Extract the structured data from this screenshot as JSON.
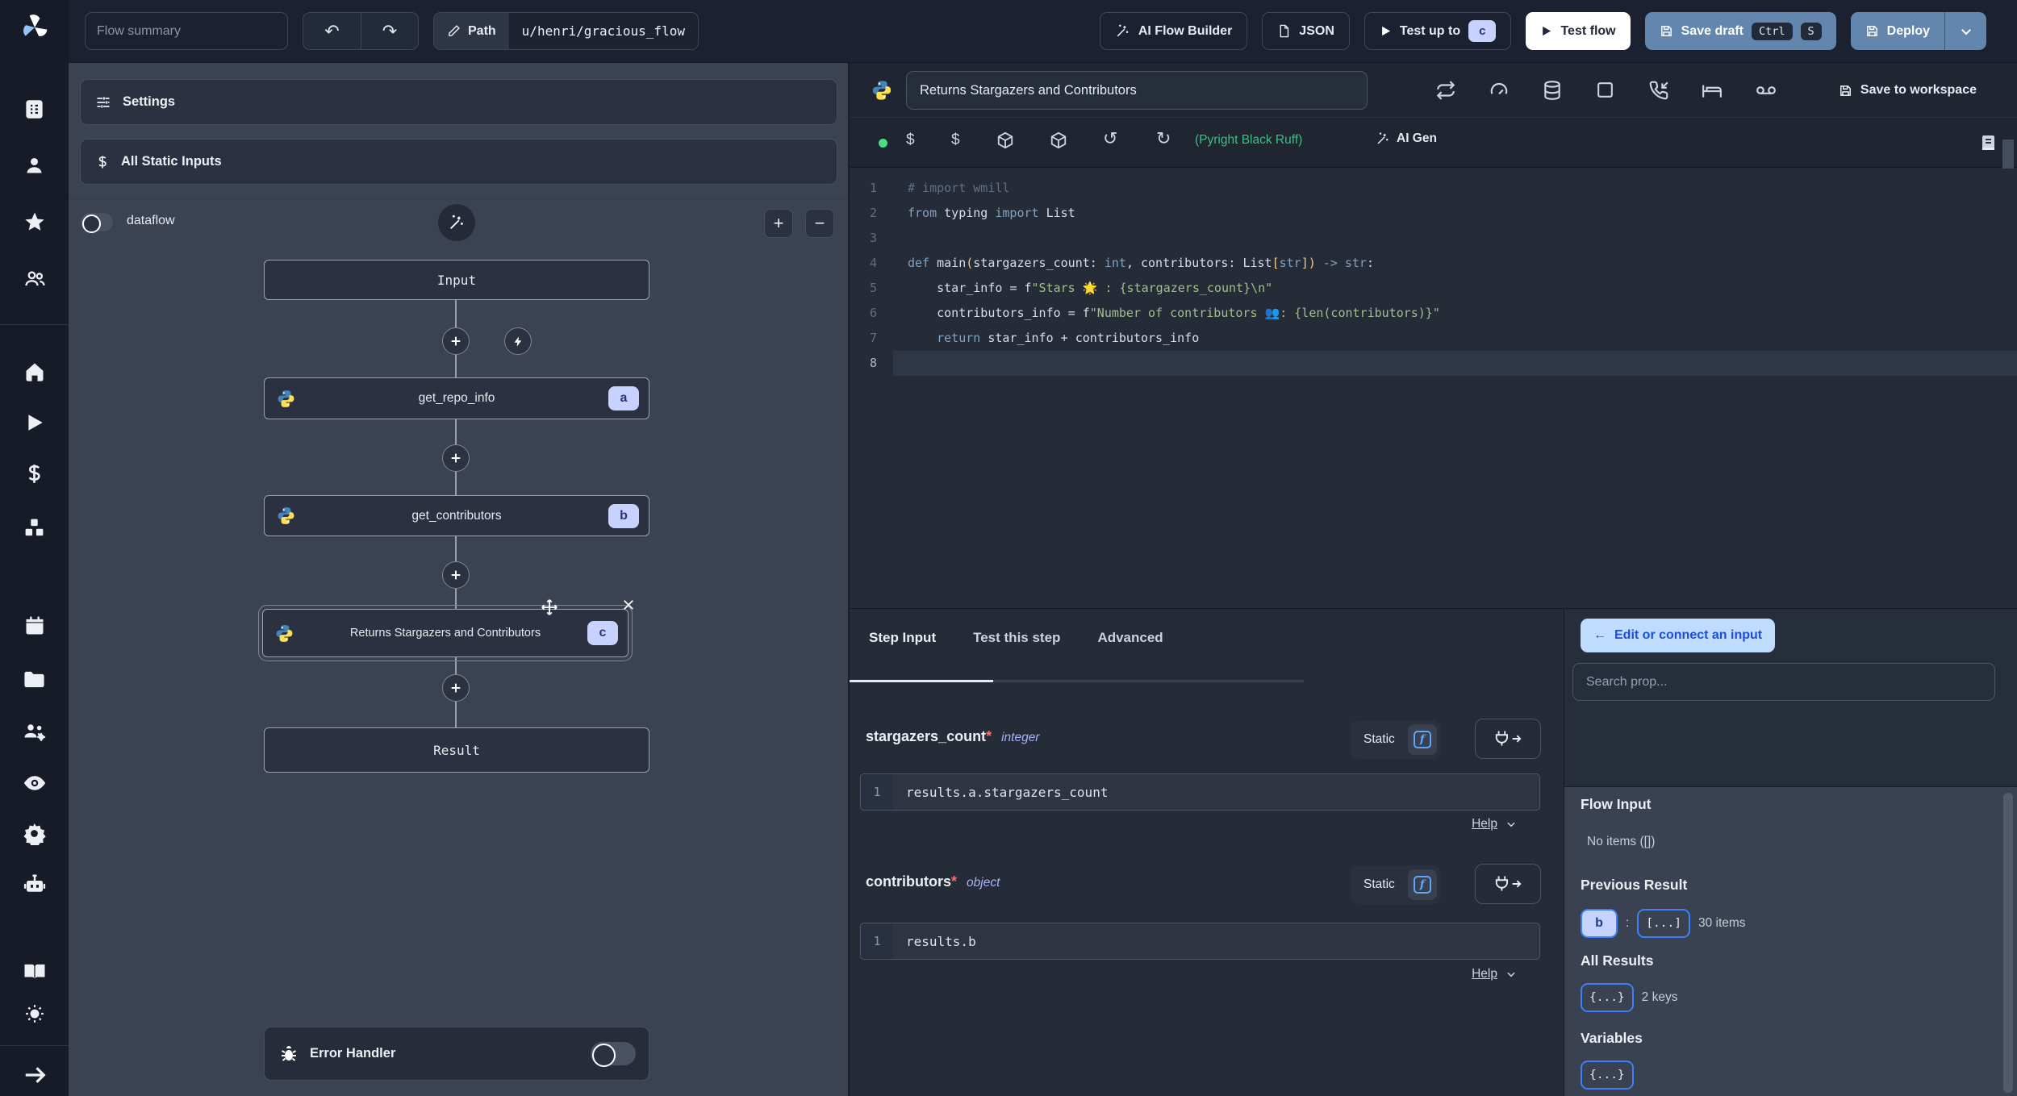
{
  "colors": {
    "accent_blue": "#6286ae",
    "badge_bg": "#c7d2fe",
    "badge_text": "#312e81",
    "lint_green": "#3fbf82",
    "connect_btn_bg": "#bfdbfe",
    "connect_btn_text": "#1d4ed8",
    "string_green": "#a3be8c",
    "keyword_blue": "#81a1c1"
  },
  "sidebar": {
    "icons": [
      "windmill-logo",
      "workspace-grid",
      "user",
      "star",
      "users",
      "home",
      "runs-play",
      "dollar",
      "resources-boxes",
      "schedules-calendar",
      "folders",
      "groups-cog",
      "eye",
      "settings-gear",
      "robot",
      "docs-book",
      "theme-sun",
      "collapse-arrow"
    ]
  },
  "topbar": {
    "flow_summary_placeholder": "Flow summary",
    "undo_glyph": "↶",
    "redo_glyph": "↷",
    "path_label": "Path",
    "path_value": "u/henri/gracious_flow",
    "ai_flow_builder": "AI Flow Builder",
    "json": "JSON",
    "test_up_to": "Test up to",
    "test_up_to_badge": "c",
    "test_flow": "Test flow",
    "save_draft": "Save draft",
    "kbd_ctrl": "Ctrl",
    "kbd_s": "S",
    "deploy": "Deploy"
  },
  "flow_panel": {
    "settings": "Settings",
    "all_static_inputs": "All Static Inputs",
    "dataflow_label": "dataflow",
    "plus": "+",
    "minus": "−",
    "input_node": "Input",
    "node_a": {
      "label": "get_repo_info",
      "badge": "a"
    },
    "node_b": {
      "label": "get_contributors",
      "badge": "b"
    },
    "node_c": {
      "label": "Returns Stargazers and Contributors",
      "badge": "c"
    },
    "result_node": "Result",
    "error_handler": "Error Handler"
  },
  "editor": {
    "title": "Returns Stargazers and Contributors",
    "save_to_workspace": "Save to workspace",
    "dollar1": "$",
    "dollar2": "$",
    "undo2": "↺",
    "redo2": "↻",
    "lint": "(Pyright Black Ruff)",
    "ai_gen": "AI Gen",
    "code": {
      "active_line": 8,
      "lines": [
        [
          [
            "# import wmill",
            "cm"
          ]
        ],
        [
          [
            "from ",
            "kw"
          ],
          [
            "typing ",
            "pl"
          ],
          [
            "import ",
            "kw"
          ],
          [
            "List",
            "pl"
          ]
        ],
        [],
        [
          [
            "def ",
            "kw"
          ],
          [
            "main",
            "pl"
          ],
          [
            "(",
            "br"
          ],
          [
            "stargazers_count",
            "pl"
          ],
          [
            ": ",
            "pl"
          ],
          [
            "int",
            "kw"
          ],
          [
            ", ",
            "pl"
          ],
          [
            "contributors",
            "pl"
          ],
          [
            ": ",
            "pl"
          ],
          [
            "List",
            "pl"
          ],
          [
            "[",
            "br"
          ],
          [
            "str",
            "kw"
          ],
          [
            "]",
            "br"
          ],
          [
            ")",
            "br"
          ],
          [
            " -> ",
            "kw"
          ],
          [
            "str",
            "kw"
          ],
          [
            ":",
            "pl"
          ]
        ],
        [
          [
            "    star_info ",
            "pl"
          ],
          [
            "= ",
            "pl"
          ],
          [
            "f",
            "pl"
          ],
          [
            "\"Stars 🌟 : {stargazers_count}\\n\"",
            "st"
          ]
        ],
        [
          [
            "    contributors_info ",
            "pl"
          ],
          [
            "= ",
            "pl"
          ],
          [
            "f",
            "pl"
          ],
          [
            "\"Number of contributors 👥: {len(contributors)}\"",
            "st"
          ]
        ],
        [
          [
            "    ",
            "pl"
          ],
          [
            "return",
            "kw"
          ],
          [
            " star_info + contributors_info",
            "pl"
          ]
        ],
        []
      ]
    }
  },
  "step_panel": {
    "tabs": [
      "Step Input",
      "Test this step",
      "Advanced"
    ],
    "fields": [
      {
        "name": "stargazers_count",
        "req": "*",
        "type": "integer",
        "mode": "Static",
        "fn_icon": "f",
        "line_no": "1",
        "expr": "results.a.stargazers_count",
        "help": "Help"
      },
      {
        "name": "contributors",
        "req": "*",
        "type": "object",
        "mode": "Static",
        "fn_icon": "f",
        "line_no": "1",
        "expr": "results.b",
        "help": "Help"
      }
    ]
  },
  "connect_panel": {
    "back_arrow": "←",
    "back_label": "Edit or connect an input",
    "search_placeholder": "Search prop...",
    "flow_input_title": "Flow Input",
    "flow_input_empty": "No items ([])",
    "previous_result_title": "Previous Result",
    "prev_key": "b",
    "colon": ":",
    "prev_obj": "[...]",
    "prev_meta": "30 items",
    "all_results_title": "All Results",
    "all_obj": "{...}",
    "all_meta": "2 keys",
    "variables_title": "Variables",
    "vars_obj": "{...}"
  }
}
